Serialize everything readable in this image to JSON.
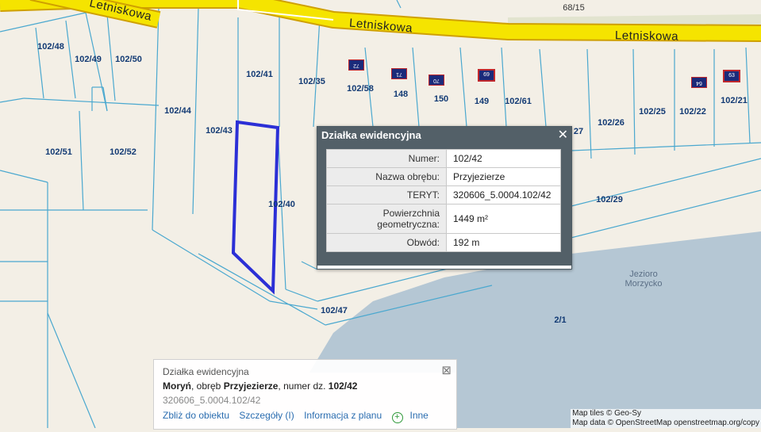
{
  "map": {
    "streets": [
      "Letniskowa",
      "Letniskowa",
      "Letniskowa"
    ],
    "parcels": [
      "102/48",
      "102/49",
      "102/50",
      "102/41",
      "102/35",
      "102/58",
      "148",
      "150",
      "149",
      "102/61",
      "102/26",
      "102/25",
      "102/22",
      "102/21",
      "102/44",
      "102/43",
      "102/51",
      "102/52",
      "102/40",
      "102/29",
      "102/47",
      "2/1",
      "68/15",
      "27"
    ],
    "house_numbers": [
      "72",
      "71",
      "70",
      "69",
      "64",
      "63"
    ],
    "lake_name": "Jezioro\nMorzycko",
    "colors": {
      "land": "#f3efe6",
      "water": "#b7c8d3",
      "road": "#f5e400",
      "parcel_line": "#4aa8cf",
      "highlight": "#2b2fd6"
    }
  },
  "popup": {
    "title": "Działka ewidencyjna",
    "rows": [
      {
        "label": "Numer:",
        "value": "102/42"
      },
      {
        "label": "Nazwa obrębu:",
        "value": "Przyjezierze"
      },
      {
        "label": "TERYT:",
        "value": "320606_5.0004.102/42"
      },
      {
        "label": "Powierzchnia geometryczna:",
        "value": "1449 m²"
      },
      {
        "label": "Obwód:",
        "value": "192 m"
      }
    ],
    "close_icon": "close-icon"
  },
  "info": {
    "title": "Działka ewidencyjna",
    "place": "Moryń",
    "sep1": ", obręb ",
    "precinct": "Przyjezierze",
    "sep2": ", numer dz. ",
    "parcel": "102/42",
    "teryt": "320606_5.0004.102/42",
    "links": [
      "Zbliż do obiektu",
      "Szczegóły (I)",
      "Informacja z planu",
      "Inne"
    ]
  },
  "attribution": {
    "tiles": "Map tiles © Geo-Sy",
    "data": "Map data © OpenStreetMap openstreetmap.org/copy"
  }
}
